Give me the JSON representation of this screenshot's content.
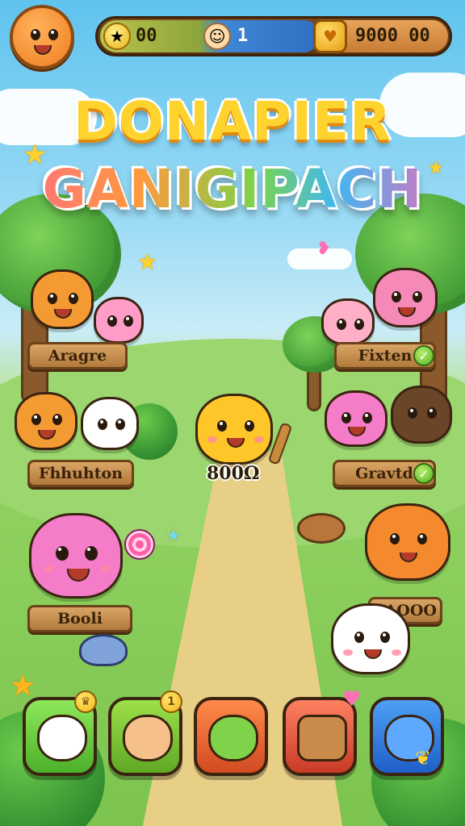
{
  "hud": {
    "coins_value": "00",
    "players_value": "1",
    "gems_value": "9000 00",
    "icons": {
      "avatar": "cat-face-icon",
      "coins": "gold-coin-icon",
      "players": "baby-face-icon",
      "gems": "heart-shield-icon"
    }
  },
  "title": {
    "line1": "DONAPIER",
    "line2": "GANIGIPACH"
  },
  "characters": [
    {
      "name": "orange-cat",
      "label": "Aragre"
    },
    {
      "name": "pink-cat",
      "label": "Fixten",
      "checked": true
    },
    {
      "name": "orange-cat-2",
      "label": "Fhhuhton"
    },
    {
      "name": "pink-cat-2",
      "label": "Gravtd",
      "checked": true
    },
    {
      "name": "pink-lollipop-cat",
      "label": "Booli"
    },
    {
      "name": "white-cat",
      "label": "/ AOOO"
    }
  ],
  "center_character": {
    "name": "yellow-cat",
    "price": "800Ω"
  },
  "slots": [
    {
      "name": "white-cat",
      "color": "#6fd24a"
    },
    {
      "name": "girl",
      "color": "#7acb3a",
      "badge": "1"
    },
    {
      "name": "green-cat",
      "color": "#e2663a"
    },
    {
      "name": "wooden-idol",
      "color": "#d9583a"
    },
    {
      "name": "blue-cat",
      "color": "#2f7de0"
    }
  ]
}
